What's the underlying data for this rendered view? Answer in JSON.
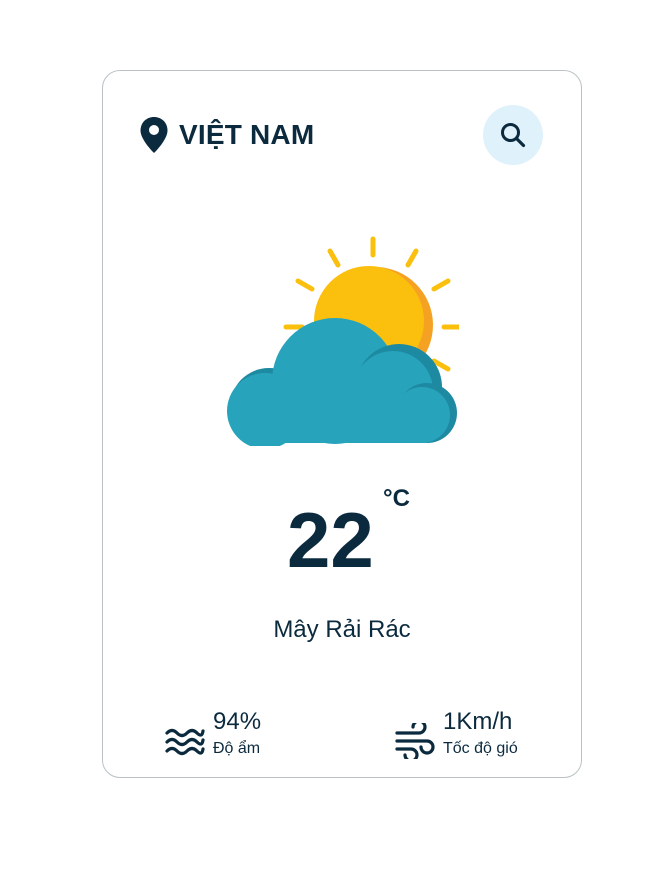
{
  "location": {
    "icon": "map-pin-icon",
    "name": "VIỆT NAM"
  },
  "search": {
    "icon": "search-icon",
    "background": "#dff1fb"
  },
  "weather": {
    "icon": "sun-behind-cloud-icon",
    "temperature": "22",
    "unit": "°C",
    "description": "Mây Rải Rác"
  },
  "stats": {
    "humidity": {
      "icon": "waves-icon",
      "value": "94%",
      "label": "Độ ẩm"
    },
    "wind": {
      "icon": "wind-icon",
      "value": "1Km/h",
      "label": "Tốc độ gió"
    }
  },
  "colors": {
    "text": "#0b2a3e",
    "sun": "#fbbf0e",
    "sun_shade": "#f5a122",
    "cloud": "#27a3bb",
    "cloud_shade": "#1d8aa2",
    "border": "#b9c2c6"
  }
}
